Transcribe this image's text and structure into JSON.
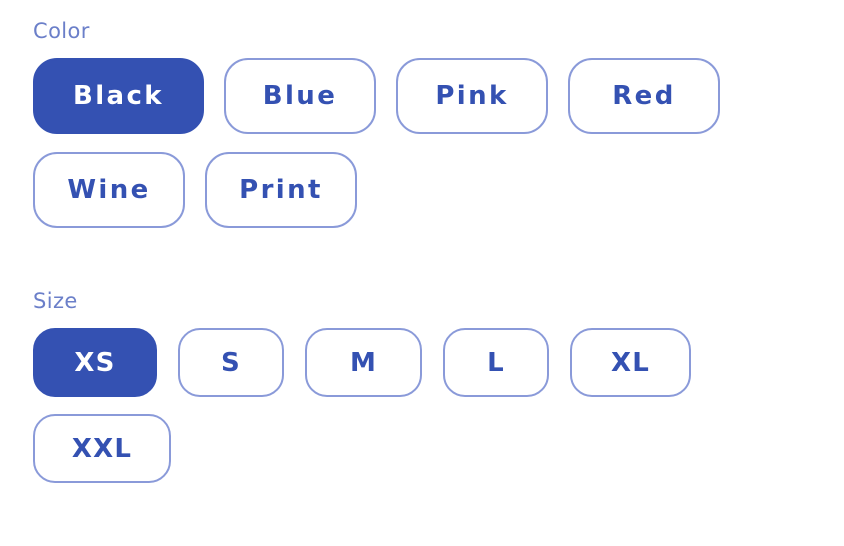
{
  "theme": {
    "accent": "#3451b2",
    "outline": "#8a9ad9",
    "label_color": "#6b7fc9",
    "background": "#ffffff",
    "selected_text": "#ffffff"
  },
  "groups": [
    {
      "id": "color",
      "label": "Color",
      "selected": "Black",
      "options": [
        {
          "label": "Black",
          "selected": true
        },
        {
          "label": "Blue",
          "selected": false
        },
        {
          "label": "Pink",
          "selected": false
        },
        {
          "label": "Red",
          "selected": false
        },
        {
          "label": "Wine",
          "selected": false
        },
        {
          "label": "Print",
          "selected": false
        }
      ]
    },
    {
      "id": "size",
      "label": "Size",
      "selected": "XS",
      "options": [
        {
          "label": "XS",
          "selected": true
        },
        {
          "label": "S",
          "selected": false
        },
        {
          "label": "M",
          "selected": false
        },
        {
          "label": "L",
          "selected": false
        },
        {
          "label": "XL",
          "selected": false
        },
        {
          "label": "XXL",
          "selected": false
        }
      ]
    }
  ]
}
